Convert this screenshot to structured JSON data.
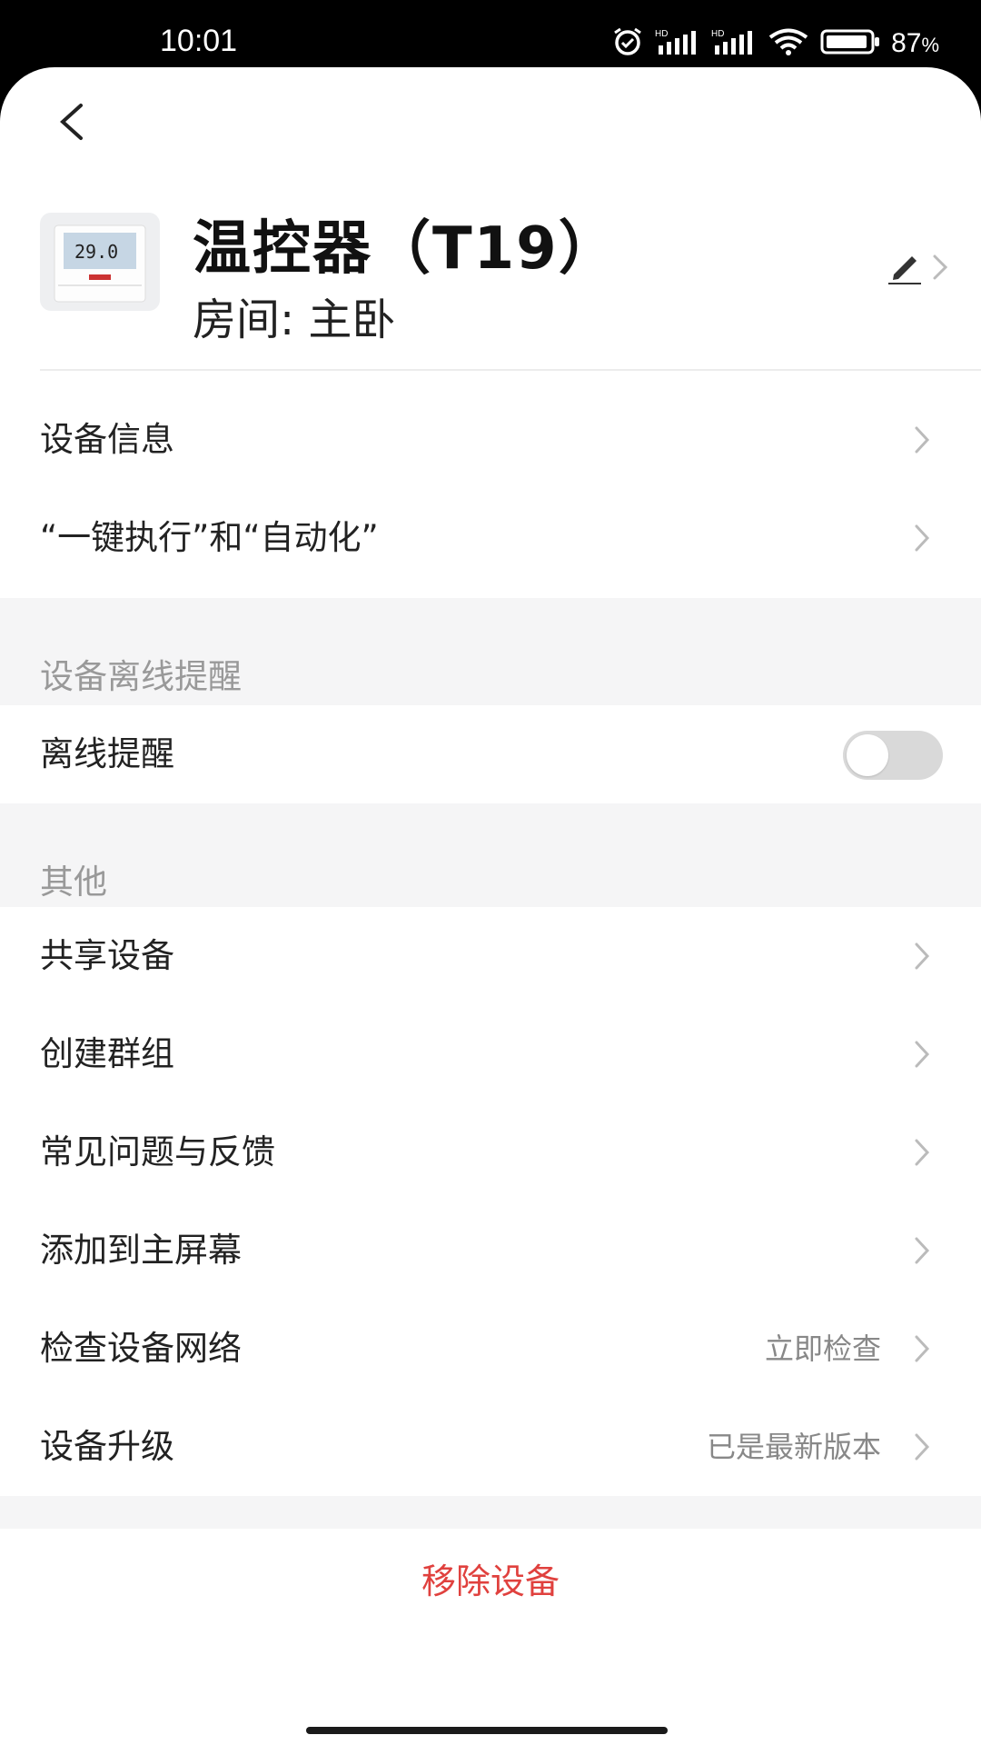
{
  "status_bar": {
    "time": "10:01",
    "battery": "87",
    "battery_unit": "%",
    "signal_label": "HD"
  },
  "header": {
    "back_icon": "chevron-left-icon"
  },
  "device": {
    "name": "温控器（T19）",
    "room": "房间: 主卧",
    "thumb_display": "29.0",
    "edit_icon": "pencil-icon"
  },
  "rows_top": [
    {
      "label": "设备信息"
    },
    {
      "label": "“一键执行”和“自动化”"
    }
  ],
  "offline_section": {
    "title": "设备离线提醒",
    "toggle_label": "离线提醒",
    "toggle_on": false
  },
  "other_section": {
    "title": "其他",
    "items": [
      {
        "label": "共享设备",
        "value": ""
      },
      {
        "label": "创建群组",
        "value": ""
      },
      {
        "label": "常见问题与反馈",
        "value": ""
      },
      {
        "label": "添加到主屏幕",
        "value": ""
      },
      {
        "label": "检查设备网络",
        "value": "立即检查"
      },
      {
        "label": "设备升级",
        "value": "已是最新版本"
      }
    ]
  },
  "remove_button": {
    "label": "移除设备",
    "color": "#e0413e"
  }
}
